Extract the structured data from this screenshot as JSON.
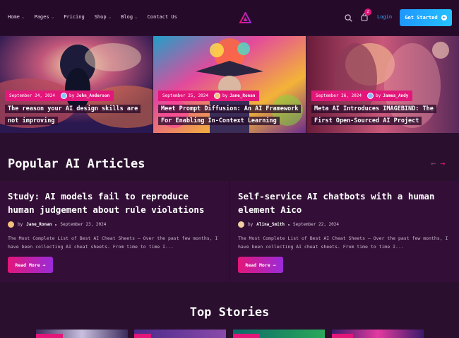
{
  "nav": {
    "items": [
      {
        "label": "Home",
        "has_dropdown": true
      },
      {
        "label": "Pages",
        "has_dropdown": true
      },
      {
        "label": "Pricing",
        "has_dropdown": false
      },
      {
        "label": "Shop",
        "has_dropdown": true
      },
      {
        "label": "Blog",
        "has_dropdown": true
      },
      {
        "label": "Contact Us",
        "has_dropdown": false
      }
    ],
    "cart_count": "2",
    "login_label": "Login",
    "cta_label": "Get Started",
    "icons": {
      "logo": "triangle-logo-icon",
      "search": "search-icon",
      "cart": "shopping-bag-icon"
    }
  },
  "hero": [
    {
      "date": "September 24, 2024",
      "by": "by",
      "author": "John_Anderson",
      "title": "The reason your AI design skills are not improving"
    },
    {
      "date": "September 25, 2024",
      "by": "by",
      "author": "Jane_Ronan",
      "title": "Meet Prompt Diffusion: An AI Framework For Enabling In-Context Learning"
    },
    {
      "date": "September 26, 2024",
      "by": "by",
      "author": "James_Andy",
      "title": "Meta AI Introduces IMAGEBIND: The First Open-Sourced AI Project"
    }
  ],
  "popular": {
    "title": "Popular AI Articles",
    "arrows": {
      "prev": "←",
      "next": "→"
    },
    "cards": [
      {
        "title": "Study: AI models fail to reproduce human judgement about rule violations",
        "by": "by",
        "author": "Jane_Ronan",
        "date": "September 23, 2024",
        "excerpt": "The Most Complete List of Best AI Cheat Sheets — Over the past few months, I have been collecting AI cheat sheets. From time to time I...",
        "button": "Read More",
        "button_icon": "→"
      },
      {
        "title": "Self-service AI chatbots with a human element Aico",
        "by": "by",
        "author": "Alina_Smith",
        "date": "September 22, 2024",
        "excerpt": "The Most Complete List of Best AI Cheat Sheets — Over the past few months, I have been collecting AI cheat sheets. From time to time I...",
        "button": "Read More",
        "button_icon": "→"
      }
    ]
  },
  "top_stories": {
    "title": "Top Stories"
  },
  "colors": {
    "background": "#2a0f2e",
    "accent": "#e3167a",
    "link": "#29b3ff",
    "cta": "#1f96ff"
  }
}
